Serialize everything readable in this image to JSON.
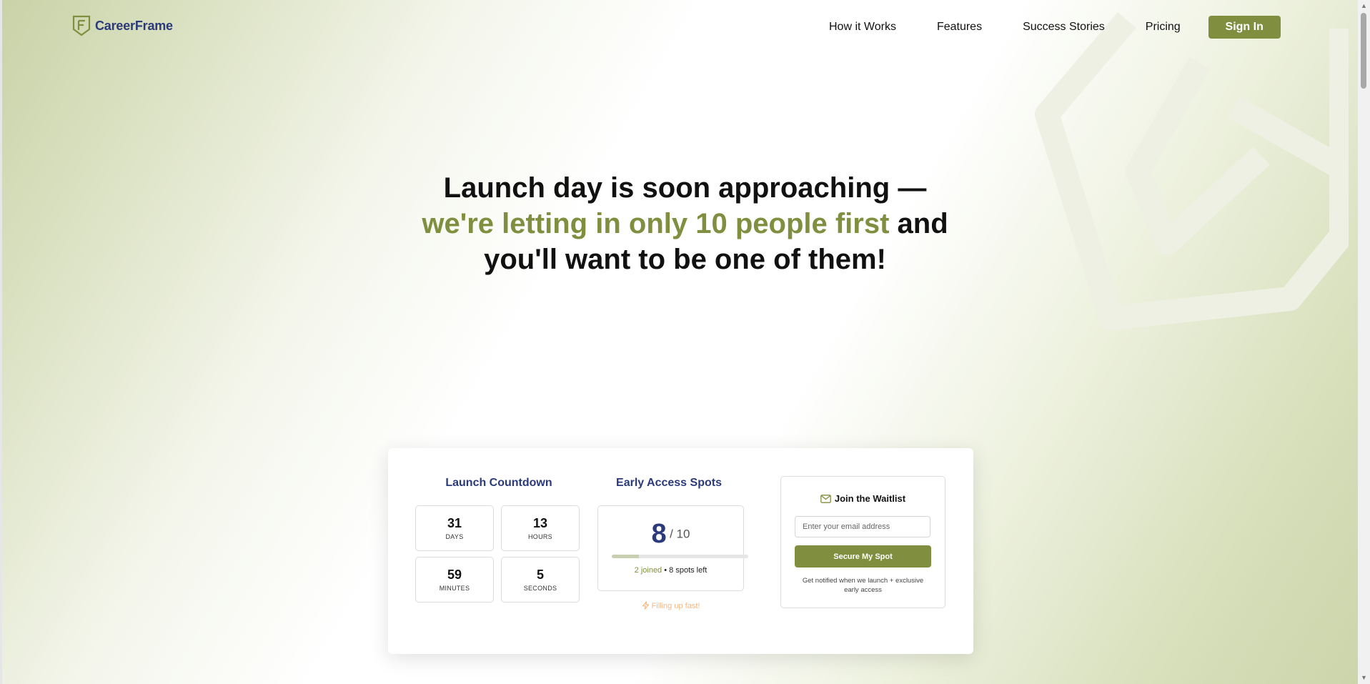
{
  "brand": {
    "name": "CareerFrame"
  },
  "nav": {
    "links": [
      "How it Works",
      "Features",
      "Success Stories",
      "Pricing"
    ],
    "signin_label": "Sign In"
  },
  "hero": {
    "line1": "Launch day is soon approaching —",
    "accent": "we're letting in only 10 people first",
    "line2_rest": " and",
    "line3": "you'll want to be one of them!"
  },
  "countdown": {
    "title": "Launch Countdown",
    "units": [
      {
        "value": "31",
        "label": "DAYS"
      },
      {
        "value": "13",
        "label": "HOURS"
      },
      {
        "value": "59",
        "label": "MINUTES"
      },
      {
        "value": "5",
        "label": "SECONDS"
      }
    ]
  },
  "spots": {
    "title": "Early Access Spots",
    "count": "8",
    "total": "/ 10",
    "progress_fraction": 0.2,
    "joined_text": "2 joined",
    "separator": " • ",
    "left_text": "8 spots left",
    "filling_text": "Filling up fast!"
  },
  "waitlist": {
    "title": "Join the Waitlist",
    "email_placeholder": "Enter your email address",
    "email_value": "",
    "button_label": "Secure My Spot",
    "note": "Get notified when we launch + exclusive early access"
  },
  "colors": {
    "accent": "#7f8f3f",
    "brand_blue": "#2a3a7a",
    "warning": "#f4b886"
  },
  "icons": {
    "logo": "shield-f-logo-icon",
    "waitlist": "mail-icon",
    "filling": "lightning-icon"
  }
}
